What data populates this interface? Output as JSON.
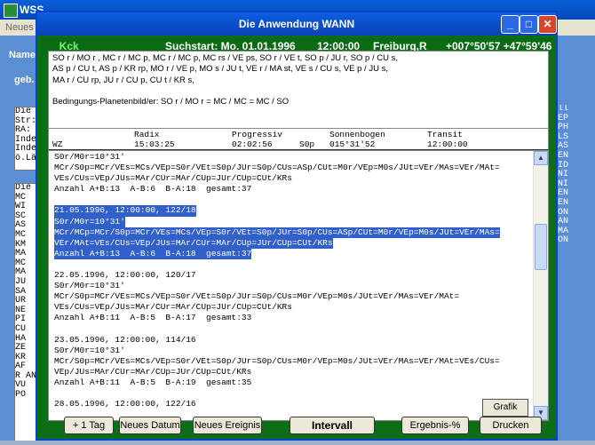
{
  "bg_window": {
    "title": "WSS ...",
    "menu_item": "Neues H",
    "name_label": "Name",
    "geb_label": "geb.",
    "left_panel_top": [
      "Die",
      "Str:",
      "RA:",
      "Inde",
      "Inde",
      "ö.Lä"
    ],
    "left_panel_bottom": [
      "Die",
      "MC",
      "WI",
      "SC",
      "AS",
      "MC",
      "KM",
      "MA",
      "MC",
      "MA",
      "JU",
      "SA",
      "UR",
      "NE",
      "PI",
      "CU",
      "HA",
      "ZE",
      "KR",
      "AF",
      "R AN",
      "VU",
      "PO"
    ],
    "right_labels": [
      "ll",
      "EP",
      "PH",
      "LS",
      "AS",
      "EN",
      "ID",
      "NI",
      "NI",
      "EN",
      "EN",
      "ON",
      "AN",
      "MA",
      "ON"
    ]
  },
  "dialog": {
    "title": "Die Anwendung WANN",
    "buttons": {
      "minimize": "_",
      "maximize": "□",
      "close": "✕"
    }
  },
  "infobar": {
    "code": "_Kck",
    "start": "Suchstart: Mo. 01.01.1996",
    "time": "12:00:00",
    "place": "Freiburg,R",
    "coords": "+007°50'57  +47°59'46"
  },
  "conditions": [
    "SO r / MO r , MC r / MC p, MC r / MC p, MC rs / VE ps, SO r / VE t, SO p / JU r, SO p / CU s,",
    "AS p / CU t, AS p / KR rp, MO r / VE p, MO s / JU t, VE r / MA st, VE s / CU s, VE p / JU s,",
    "MA r / CU rp, JU r / CU p, CU t / KR s,",
    "",
    "Bedingungs-Planetenbild/er: SO r / MO r = MC / MC = MC / SO"
  ],
  "columns": {
    "headers": [
      "Radix",
      "Progressiv",
      "Sonnenbogen",
      "Transit"
    ],
    "wz_label": "WZ",
    "radix_time": "15:03:25",
    "prog_time": "02:02:56",
    "sob_prefix": "S0p",
    "sob_value": "015°31'52",
    "transit_time": "12:00:00"
  },
  "text_lines": [
    {
      "text": "S0r/M0r=10°31'",
      "sel": false
    },
    {
      "text": "MCr/S0p=MCr/VEs=MCs/VEp=S0r/VEt=S0p/JUr=S0p/CUs=ASp/CUt=M0r/VEp=M0s/JUt=VEr/MAs=VEr/MAt=",
      "sel": false
    },
    {
      "text": "VEs/CUs=VEp/JUs=MAr/CUr=MAr/CUp=JUr/CUp=CUt/KRs",
      "sel": false
    },
    {
      "text": "Anzahl A+B:13  A-B:6  B-A:18  gesamt:37",
      "sel": false
    },
    {
      "text": "",
      "sel": false
    },
    {
      "text": "21.05.1996, 12:00:00, 122/18",
      "sel": true
    },
    {
      "text": "S0r/M0r=10°31'",
      "sel": true
    },
    {
      "text": "MCr/MCp=MCr/S0p=MCr/VEs=MCs/VEp=S0r/VEt=S0p/JUr=S0p/CUs=ASp/CUt=M0r/VEp=M0s/JUt=VEr/MAs=",
      "sel": true
    },
    {
      "text": "VEr/MAt=VEs/CUs=VEp/JUs=MAr/CUr=MAr/CUp=JUr/CUp=CUt/KRs",
      "sel": true
    },
    {
      "text": "Anzahl A+B:13  A-B:6  B-A:18  gesamt:37",
      "sel": true
    },
    {
      "text": "",
      "sel": false
    },
    {
      "text": "22.05.1996, 12:00:00, 120/17",
      "sel": false
    },
    {
      "text": "S0r/M0r=10°31'",
      "sel": false
    },
    {
      "text": "MCr/S0p=MCr/VEs=MCs/VEp=S0r/VEt=S0p/JUr=S0p/CUs=M0r/VEp=M0s/JUt=VEr/MAs=VEr/MAt=",
      "sel": false
    },
    {
      "text": "VEs/CUs=VEp/JUs=MAr/CUr=MAr/CUp=JUr/CUp=CUt/KRs",
      "sel": false
    },
    {
      "text": "Anzahl A+B:11  A-B:5  B-A:17  gesamt:33",
      "sel": false
    },
    {
      "text": "",
      "sel": false
    },
    {
      "text": "23.05.1996, 12:00:00, 114/16",
      "sel": false
    },
    {
      "text": "S0r/M0r=10°31'",
      "sel": false
    },
    {
      "text": "MCr/S0p=MCr/VEs=MCs/VEp=S0r/VEt=S0p/JUr=S0p/CUs=M0r/VEp=M0s/JUt=VEr/MAs=VEr/MAt=VEs/CUs=",
      "sel": false
    },
    {
      "text": "VEp/JUs=MAr/CUr=MAr/CUp=JUr/CUp=CUt/KRs",
      "sel": false
    },
    {
      "text": "Anzahl A+B:11  A-B:5  B-A:19  gesamt:35",
      "sel": false
    },
    {
      "text": "",
      "sel": false
    },
    {
      "text": "28.05.1996, 12:00:00, 122/16",
      "sel": false
    }
  ],
  "grafik_label": "Grafik",
  "buttons": [
    "+ 1 Tag",
    "Neues Datum",
    "Neues Ereignis",
    "Intervall",
    "Ergebnis-%",
    "Drucken"
  ],
  "colors": {
    "dialog_green": "#0e6d17",
    "selection": "#3160c8",
    "title_blue": "#0a5fe0"
  }
}
